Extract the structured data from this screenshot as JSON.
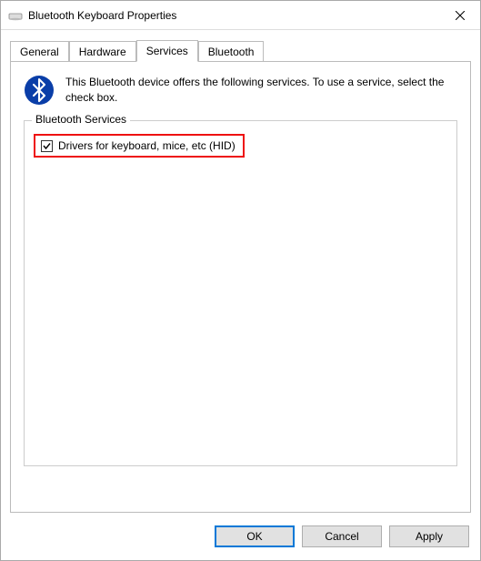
{
  "window": {
    "title": "Bluetooth Keyboard Properties"
  },
  "tabs": {
    "general": "General",
    "hardware": "Hardware",
    "services": "Services",
    "bluetooth": "Bluetooth"
  },
  "panel": {
    "description": "This Bluetooth device offers the following services. To use a service, select the check box.",
    "fieldset_legend": "Bluetooth Services",
    "service_hid": "Drivers for keyboard, mice, etc (HID)",
    "service_hid_checked": true
  },
  "buttons": {
    "ok": "OK",
    "cancel": "Cancel",
    "apply": "Apply"
  }
}
